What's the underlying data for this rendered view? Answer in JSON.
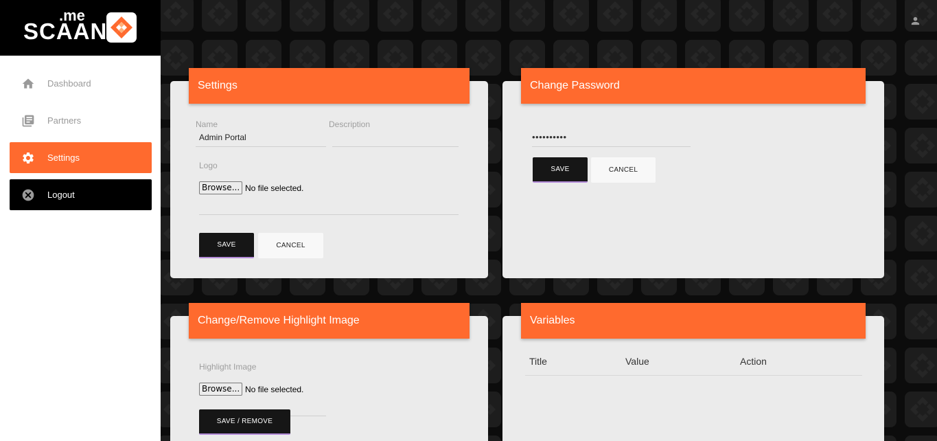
{
  "brand": {
    "top": ".me",
    "name": "SCAAN",
    "logo_icon": "scaan-logo-icon"
  },
  "nav": {
    "items": [
      {
        "label": "Dashboard",
        "icon": "home-icon"
      },
      {
        "label": "Partners",
        "icon": "library-books-icon"
      },
      {
        "label": "Settings",
        "icon": "gear-icon",
        "active": true
      },
      {
        "label": "Logout",
        "icon": "close-circle-icon"
      }
    ]
  },
  "header": {
    "user_icon": "user-icon"
  },
  "settings_card": {
    "title": "Settings",
    "name_label": "Name",
    "name_value": "Admin Portal",
    "description_label": "Description",
    "description_value": "",
    "logo_label": "Logo",
    "browse_label": "Browse...",
    "file_status": "No file selected.",
    "save_label": "SAVE",
    "cancel_label": "CANCEL"
  },
  "password_card": {
    "title": "Change Password",
    "password_value": "••••••••••",
    "save_label": "SAVE",
    "cancel_label": "CANCEL"
  },
  "highlight_card": {
    "title": "Change/Remove Highlight Image",
    "label": "Highlight Image",
    "browse_label": "Browse...",
    "file_status": "No file selected.",
    "button_label": "SAVE / REMOVE"
  },
  "variables_card": {
    "title": "Variables",
    "columns": [
      "Title",
      "Value",
      "Action"
    ]
  },
  "colors": {
    "accent": "#ff6a2e",
    "dark": "#000000",
    "card": "#ebebeb"
  }
}
